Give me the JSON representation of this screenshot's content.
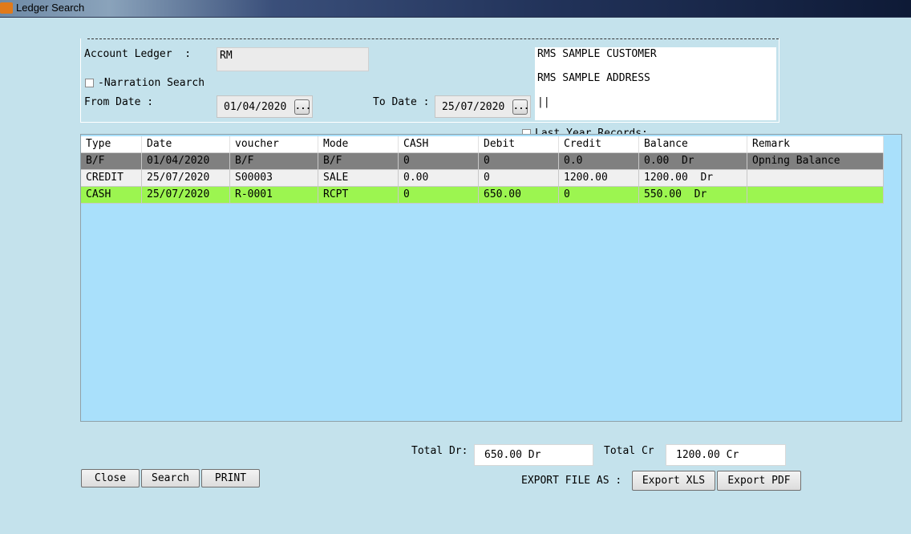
{
  "window": {
    "title": "Ledger Search"
  },
  "form": {
    "account_ledger_label": "Account Ledger  :",
    "account_ledger_value": "RM",
    "narration_label": "-Narration Search",
    "from_date_label": "From Date :",
    "from_date_value": "01/04/2020",
    "to_date_label": "To Date :",
    "to_date_value": "25/07/2020",
    "browse_label": "...",
    "last_year_label": "Last Year Records:",
    "address_lines": [
      "RMS SAMPLE CUSTOMER",
      "RMS SAMPLE ADDRESS",
      "||"
    ]
  },
  "grid": {
    "columns": [
      "Type",
      "Date",
      "voucher",
      "Mode",
      "CASH",
      "Debit",
      "Credit",
      "Balance",
      "Remark"
    ],
    "rows": [
      {
        "cells": [
          "B/F",
          "01/04/2020",
          "B/F",
          "B/F",
          "0",
          "0",
          "0.0",
          "0.00  Dr",
          "Opning Balance"
        ],
        "bg": "#808080"
      },
      {
        "cells": [
          "CREDIT",
          "25/07/2020",
          "S00003",
          "SALE",
          "0.00",
          "0",
          "1200.00",
          "1200.00  Dr",
          ""
        ],
        "bg": "#f0f0f0"
      },
      {
        "cells": [
          "CASH",
          "25/07/2020",
          "R-0001",
          "RCPT",
          "0",
          "650.00",
          "0",
          "550.00  Dr",
          ""
        ],
        "bg": "#9cf550"
      }
    ]
  },
  "totals": {
    "dr_label": "Total Dr:",
    "dr_value": "650.00 Dr",
    "cr_label": "Total Cr",
    "cr_value": "1200.00 Cr"
  },
  "buttons": {
    "close": "Close",
    "search": "Search",
    "print": "PRINT",
    "export_label": "EXPORT FILE AS :",
    "export_xls": "Export XLS",
    "export_pdf": "Export PDF"
  }
}
